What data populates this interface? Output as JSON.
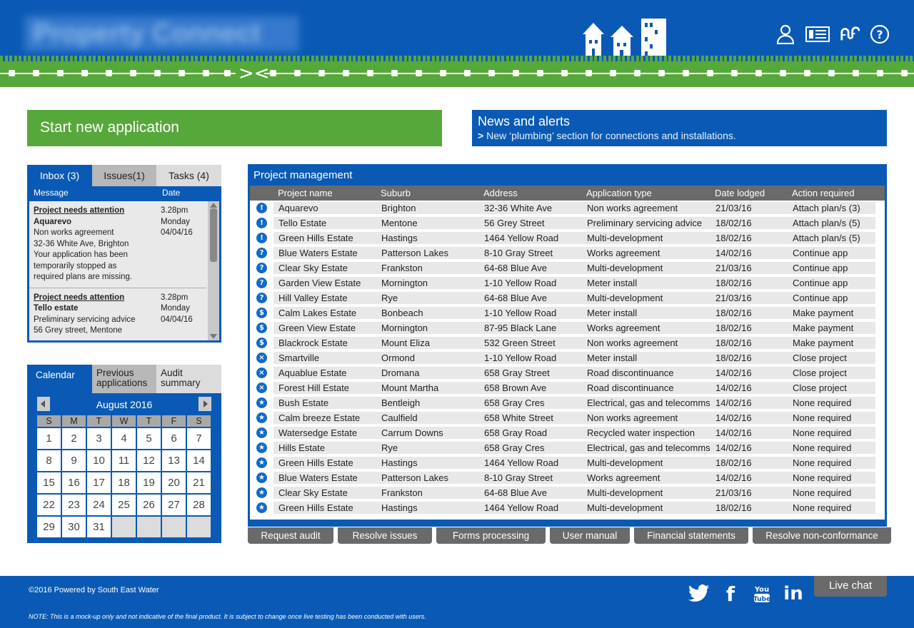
{
  "header": {
    "logo_text": "Property Connect",
    "icons": [
      "user-icon",
      "dashboard-icon",
      "water-icon",
      "help-icon"
    ]
  },
  "start_button": "Start new application",
  "news": {
    "title": "News and alerts",
    "marker": ">",
    "item": "New ‘plumbing’ section for connections and installations."
  },
  "inbox": {
    "tabs": [
      "Inbox (3)",
      "Issues(1)",
      "Tasks (4)"
    ],
    "col_message": "Message",
    "col_date": "Date",
    "messages": [
      {
        "title": "Project needs attention",
        "name": "Aquarevo",
        "lines": [
          "Non works agreement",
          "32-36 White Ave, Brighton",
          "Your application has been",
          "temporarily stopped as",
          "required plans are missing."
        ],
        "time": "3.28pm",
        "day": "Monday",
        "date": "04/04/16"
      },
      {
        "title": "Project needs attention",
        "name": "Tello estate",
        "lines": [
          "Preliminary servicing advice",
          "56 Grey street, Mentone"
        ],
        "time": "3.28pm",
        "day": "Monday",
        "date": "04/04/16"
      }
    ]
  },
  "calendar": {
    "tabs": [
      "Calendar",
      "Previous applications",
      "Audit summary"
    ],
    "month": "August 2016",
    "dow": [
      "S",
      "M",
      "T",
      "W",
      "T",
      "F",
      "S"
    ],
    "days": [
      "1",
      "2",
      "3",
      "4",
      "5",
      "6",
      "7",
      "8",
      "9",
      "10",
      "11",
      "12",
      "13",
      "14",
      "15",
      "16",
      "17",
      "18",
      "19",
      "20",
      "21",
      "22",
      "23",
      "24",
      "25",
      "26",
      "27",
      "28",
      "29",
      "30",
      "31",
      "",
      "",
      "",
      ""
    ]
  },
  "project": {
    "title": "Project management",
    "columns": [
      "Project name",
      "Suburb",
      "Address",
      "Application type",
      "Date lodged",
      "Action required"
    ],
    "rows": [
      {
        "icon": "!",
        "name": "Aquarevo",
        "suburb": "Brighton",
        "address": "32-36 White Ave",
        "type": "Non works agreement",
        "date": "21/03/16",
        "action": "Attach plan/s (3)"
      },
      {
        "icon": "!",
        "name": "Tello Estate",
        "suburb": "Mentone",
        "address": "56 Grey Street",
        "type": "Preliminary servicing advice",
        "date": "18/02/16",
        "action": "Attach plan/s (5)"
      },
      {
        "icon": "!",
        "name": "Green Hills Estate",
        "suburb": "Hastings",
        "address": "1464 Yellow Road",
        "type": "Multi-development",
        "date": "18/02/16",
        "action": "Attach plan/s (5)"
      },
      {
        "icon": "?",
        "name": "Blue Waters Estate",
        "suburb": "Patterson Lakes",
        "address": "8-10 Gray Street",
        "type": "Works agreement",
        "date": "14/02/16",
        "action": "Continue app"
      },
      {
        "icon": "?",
        "name": "Clear Sky Estate",
        "suburb": "Frankston",
        "address": "64-68 Blue Ave",
        "type": "Multi-development",
        "date": "21/03/16",
        "action": "Continue app"
      },
      {
        "icon": "?",
        "name": "Garden View Estate",
        "suburb": "Mornington",
        "address": "1-10 Yellow Road",
        "type": "Meter install",
        "date": "18/02/16",
        "action": "Continue app"
      },
      {
        "icon": "?",
        "name": "Hill Valley Estate",
        "suburb": "Rye",
        "address": "64-68 Blue Ave",
        "type": "Multi-development",
        "date": "21/03/16",
        "action": "Continue app"
      },
      {
        "icon": "$",
        "name": "Calm Lakes Estate",
        "suburb": "Bonbeach",
        "address": "1-10 Yellow Road",
        "type": "Meter install",
        "date": "18/02/16",
        "action": "Make payment"
      },
      {
        "icon": "$",
        "name": "Green View Estate",
        "suburb": "Mornington",
        "address": "87-95 Black Lane",
        "type": "Works agreement",
        "date": "18/02/16",
        "action": "Make payment"
      },
      {
        "icon": "$",
        "name": "Blackrock Estate",
        "suburb": "Mount Eliza",
        "address": "532 Green Street",
        "type": "Non works agreement",
        "date": "18/02/16",
        "action": "Make payment"
      },
      {
        "icon": "×",
        "name": "Smartville",
        "suburb": "Ormond",
        "address": "1-10 Yellow Road",
        "type": "Meter install",
        "date": "18/02/16",
        "action": "Close project"
      },
      {
        "icon": "×",
        "name": "Aquablue Estate",
        "suburb": "Dromana",
        "address": "658 Gray Street",
        "type": "Road discontinuance",
        "date": "14/02/16",
        "action": "Close project"
      },
      {
        "icon": "×",
        "name": "Forest Hill Estate",
        "suburb": "Mount Martha",
        "address": "658 Brown Ave",
        "type": "Road discontinuance",
        "date": "14/02/16",
        "action": "Close project"
      },
      {
        "icon": "★",
        "name": "Bush Estate",
        "suburb": "Bentleigh",
        "address": "658 Gray Cres",
        "type": "Electrical, gas and telecomms",
        "date": "14/02/16",
        "action": "None required"
      },
      {
        "icon": "★",
        "name": "Calm breeze Estate",
        "suburb": "Caulfield",
        "address": "658 White Street",
        "type": "Non works agreement",
        "date": "14/02/16",
        "action": "None required"
      },
      {
        "icon": "★",
        "name": "Watersedge Estate",
        "suburb": "Carrum Downs",
        "address": "658 Gray Road",
        "type": "Recycled water inspection",
        "date": "14/02/16",
        "action": "None required"
      },
      {
        "icon": "★",
        "name": "Hills Estate",
        "suburb": "Rye",
        "address": "658 Gray Cres",
        "type": "Electrical, gas and telecomms",
        "date": "14/02/16",
        "action": "None required"
      },
      {
        "icon": "★",
        "name": "Green Hills Estate",
        "suburb": "Hastings",
        "address": "1464 Yellow Road",
        "type": "Multi-development",
        "date": "18/02/16",
        "action": "None required"
      },
      {
        "icon": "★",
        "name": "Blue Waters Estate",
        "suburb": "Patterson Lakes",
        "address": "8-10 Gray Street",
        "type": "Works agreement",
        "date": "14/02/16",
        "action": "None required"
      },
      {
        "icon": "★",
        "name": "Clear Sky Estate",
        "suburb": "Frankston",
        "address": "64-68 Blue Ave",
        "type": "Multi-development",
        "date": "21/03/16",
        "action": "None required"
      },
      {
        "icon": "★",
        "name": "Green Hills Estate",
        "suburb": "Hastings",
        "address": "1464 Yellow Road",
        "type": "Multi-development",
        "date": "18/02/16",
        "action": "None required"
      }
    ]
  },
  "actions": [
    "Request audit",
    "Resolve issues",
    "Forms processing",
    "User manual",
    "Financial statements",
    "Resolve non-conformance"
  ],
  "footer": {
    "copyright": "©2016 Powered by South East Water",
    "note": "NOTE: This is a mock-up only and not indicative of the final product. It is subject to change once live testing has been conducted with users.",
    "social": [
      "twitter-icon",
      "facebook-icon",
      "youtube-icon",
      "linkedin-icon"
    ],
    "livechat": "Live chat"
  },
  "colors": {
    "brand_blue": "#0a5ab5",
    "green": "#57a83a",
    "gray": "#6a6a6a"
  }
}
